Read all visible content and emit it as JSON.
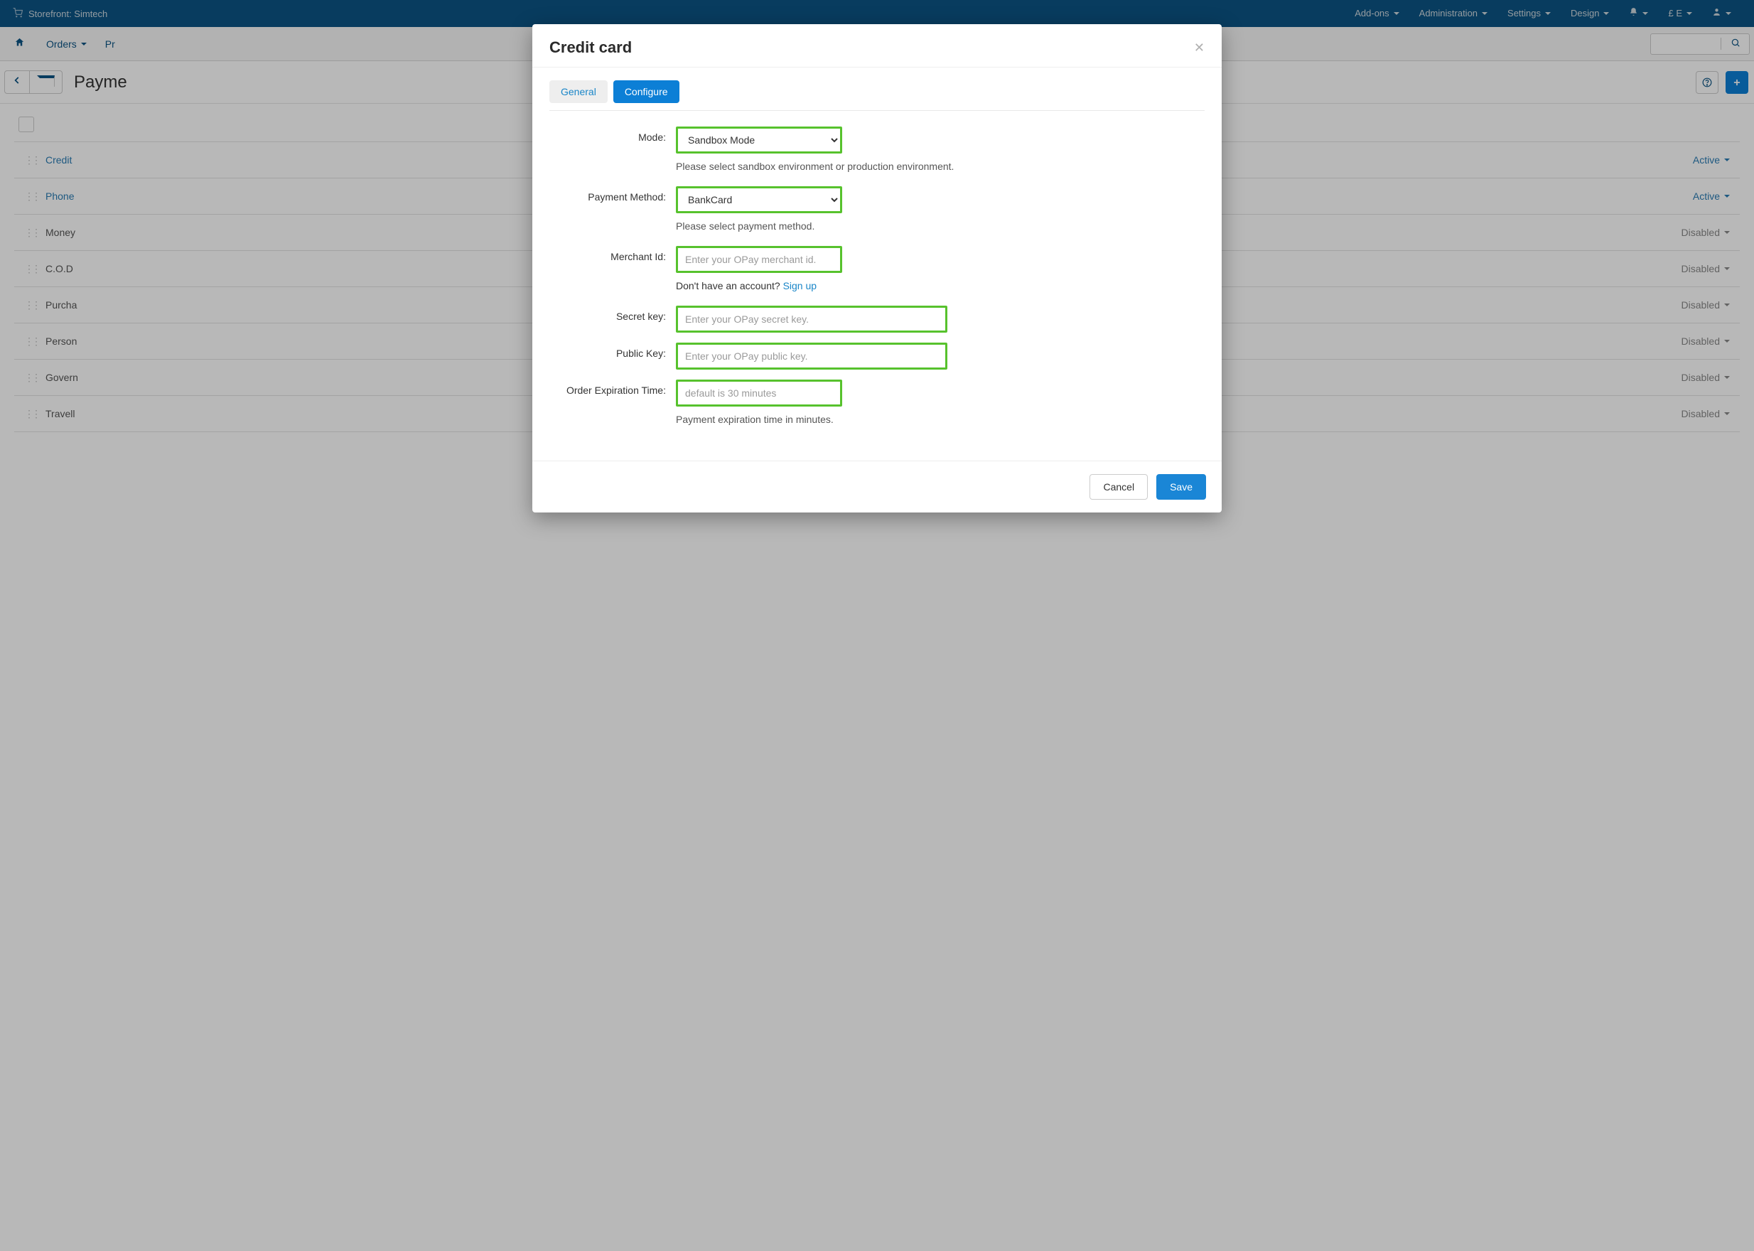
{
  "topnav": {
    "storefront_label": "Storefront: Simtech",
    "menus": [
      "Add-ons",
      "Administration",
      "Settings",
      "Design"
    ],
    "currency_label": "£ E"
  },
  "subnav": {
    "orders": "Orders",
    "products_prefix": "Pr"
  },
  "titlebar": {
    "title": "Payme"
  },
  "list": {
    "rows": [
      {
        "name": "Credit",
        "status": "Active",
        "active": true
      },
      {
        "name": "Phone",
        "status": "Active",
        "active": true
      },
      {
        "name": "Money",
        "status": "Disabled",
        "active": false
      },
      {
        "name": "C.O.D",
        "status": "Disabled",
        "active": false
      },
      {
        "name": "Purcha",
        "status": "Disabled",
        "active": false
      },
      {
        "name": "Person",
        "status": "Disabled",
        "active": false
      },
      {
        "name": "Govern",
        "status": "Disabled",
        "active": false
      },
      {
        "name": "Travell",
        "status": "Disabled",
        "active": false
      }
    ]
  },
  "modal": {
    "title": "Credit card",
    "tabs": {
      "general": "General",
      "configure": "Configure"
    },
    "labels": {
      "mode": "Mode:",
      "payment_method": "Payment Method:",
      "merchant_id": "Merchant Id:",
      "secret_key": "Secret key:",
      "public_key": "Public Key:",
      "order_expiration": "Order Expiration Time:"
    },
    "values": {
      "mode": "Sandbox Mode",
      "payment_method": "BankCard"
    },
    "placeholders": {
      "merchant_id": "Enter your OPay merchant id.",
      "secret_key": "Enter your OPay secret key.",
      "public_key": "Enter your OPay public key.",
      "order_expiration": "default is 30 minutes"
    },
    "hints": {
      "mode": "Please select sandbox environment or production environment.",
      "payment_method": "Please select payment method.",
      "order_expiration": "Payment expiration time in minutes."
    },
    "signup": {
      "question": "Don't have an account? ",
      "link": "Sign up"
    },
    "footer": {
      "cancel": "Cancel",
      "save": "Save"
    }
  }
}
